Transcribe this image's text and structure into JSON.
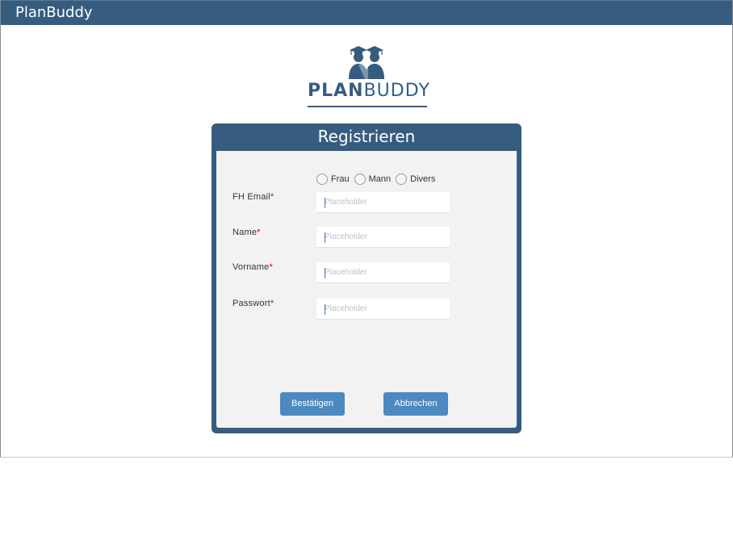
{
  "window": {
    "title": "PlanBuddy"
  },
  "logo": {
    "text_bold": "PLAN",
    "text_light": "BUDDY"
  },
  "form": {
    "title": "Registrieren",
    "gender_options": [
      "Frau",
      "Mann",
      "Divers"
    ],
    "fields": [
      {
        "label": "FH Email",
        "required": "*",
        "placeholder": "Placeholder"
      },
      {
        "label": "Name",
        "required": "*",
        "placeholder": "Placeholder"
      },
      {
        "label": "Vorname",
        "required": "*",
        "placeholder": "Placeholder"
      },
      {
        "label": "Passwort",
        "required": "*",
        "placeholder": "Placeholder"
      }
    ],
    "confirm_label": "Bestätigen",
    "cancel_label": "Abbrechen"
  },
  "colors": {
    "primary": "#365d80",
    "button": "#4a8ac0",
    "panel": "#f2f2f2",
    "required": "#d40000"
  }
}
